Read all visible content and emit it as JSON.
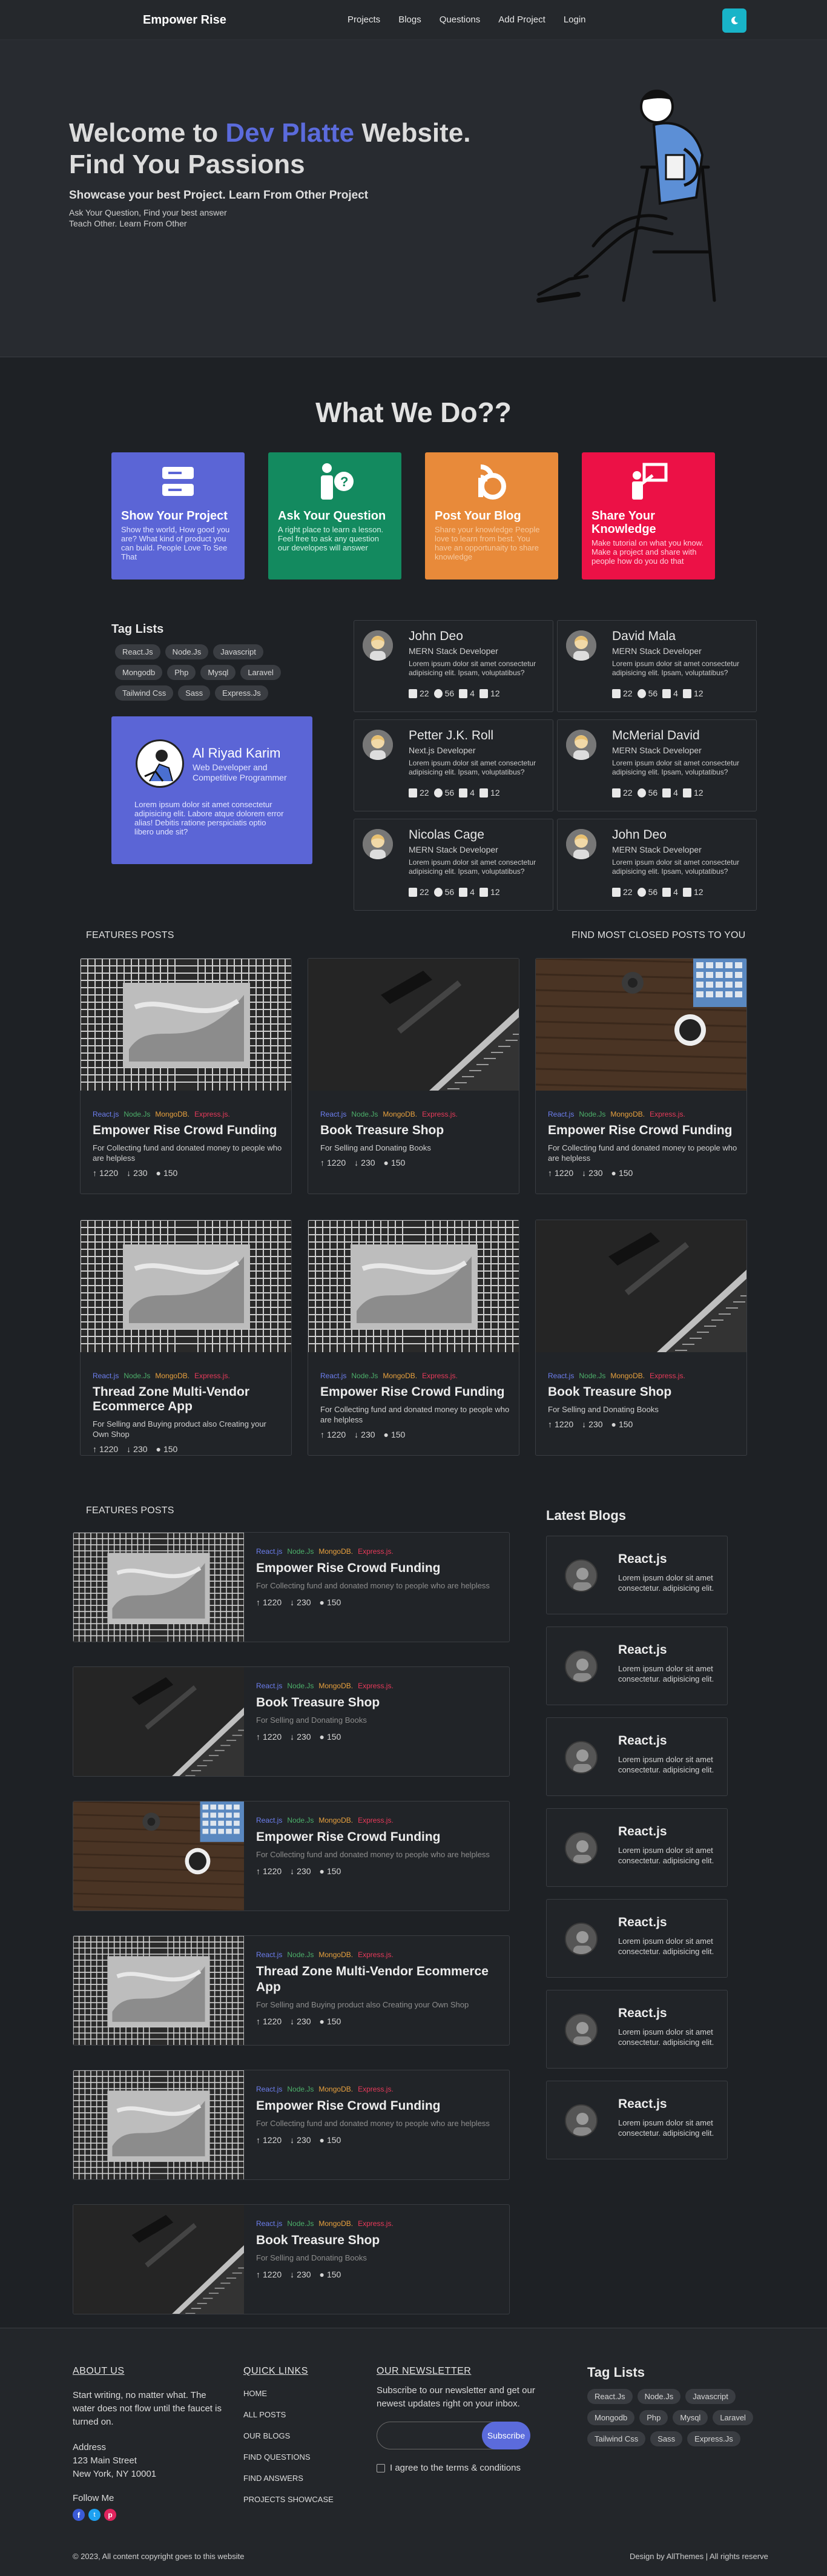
{
  "nav": {
    "brand": "Empower Rise",
    "links": [
      "Projects",
      "Blogs",
      "Questions",
      "Add Project",
      "Login"
    ]
  },
  "hero": {
    "title_pre": "Welcome to ",
    "title_highlight": "Dev Platte",
    "title_post": " Website. Find You Passions",
    "subtitle": "Showcase your best Project. Learn From Other Project",
    "text": "Ask Your Question, Find your best answer Teach Other. Learn From Other"
  },
  "what": {
    "title": "What We Do??",
    "services": [
      {
        "title": "Show Your Project",
        "text": "Show the world, How good you are? What kind of product you can build. People Love To See That",
        "bg": "#5b65d6",
        "fg": "#e2e5ff"
      },
      {
        "title": "Ask Your Question",
        "text": "A right place to learn a lesson. Feel free to ask any question our developes will answer",
        "bg": "#138a5f",
        "fg": "#d6f2e7"
      },
      {
        "title": "Post Your Blog",
        "text": "Share your knowledge People love to learn from best. You have an opportunaity to share knowledge",
        "bg": "#e88a3a",
        "fg": "#f6c99f"
      },
      {
        "title": "Share Your Knowledge",
        "text": "Make tutorial on what you know. Make a project and share with people how do you do that",
        "bg": "#ec1146",
        "fg": "#ffd3dd"
      }
    ]
  },
  "tags": {
    "title": "Tag Lists",
    "items": [
      "React.Js",
      "Node.Js",
      "Javascript",
      "Mongodb",
      "Php",
      "Mysql",
      "Laravel",
      "Tailwind Css",
      "Sass",
      "Express.Js"
    ]
  },
  "author": {
    "name": "Al Riyad Karim",
    "role": "Web Developer and Competitive Programmer",
    "desc": "Lorem ipsum dolor sit amet consectetur adipisicing elit. Labore atque dolorem error alias! Debitis ratione perspiciatis optio libero unde sit?"
  },
  "profiles": [
    {
      "name": "John Deo",
      "role": "MERN Stack Developer",
      "desc": "Lorem ipsum dolor sit amet consectetur adipisicing elit. Ipsam, voluptatibus?",
      "s1": "22",
      "s2": "56",
      "s3": "4",
      "s4": "12"
    },
    {
      "name": "David Mala",
      "role": "MERN Stack Developer",
      "desc": "Lorem ipsum dolor sit amet consectetur adipisicing elit. Ipsam, voluptatibus?",
      "s1": "22",
      "s2": "56",
      "s3": "4",
      "s4": "12"
    },
    {
      "name": "Petter J.K. Roll",
      "role": "Next.js Developer",
      "desc": "Lorem ipsum dolor sit amet consectetur adipisicing elit. Ipsam, voluptatibus?",
      "s1": "22",
      "s2": "56",
      "s3": "4",
      "s4": "12"
    },
    {
      "name": "McMerial David",
      "role": "MERN Stack Developer",
      "desc": "Lorem ipsum dolor sit amet consectetur adipisicing elit. Ipsam, voluptatibus?",
      "s1": "22",
      "s2": "56",
      "s3": "4",
      "s4": "12"
    },
    {
      "name": "Nicolas Cage",
      "role": "MERN Stack Developer",
      "desc": "Lorem ipsum dolor sit amet consectetur adipisicing elit. Ipsam, voluptatibus?",
      "s1": "22",
      "s2": "56",
      "s3": "4",
      "s4": "12"
    },
    {
      "name": "John Deo",
      "role": "MERN Stack Developer",
      "desc": "Lorem ipsum dolor sit amet consectetur adipisicing elit. Ipsam, voluptatibus?",
      "s1": "22",
      "s2": "56",
      "s3": "4",
      "s4": "12"
    }
  ],
  "features": {
    "label_left": "FEATURES POSTS",
    "label_right": "FIND MOST CLOSED POSTS TO YOU",
    "techs": [
      "React.js",
      "Node.Js",
      "MongoDB.",
      "Express.js."
    ],
    "cards": [
      {
        "title": "Empower Rise Crowd Funding",
        "desc": "For Collecting fund and donated money to people who are helpless",
        "img": "building",
        "up": "1220",
        "down": "230",
        "comments": "150"
      },
      {
        "title": "Book Treasure Shop",
        "desc": "For Selling and Donating Books",
        "img": "laptop",
        "up": "1220",
        "down": "230",
        "comments": "150"
      },
      {
        "title": "Empower Rise Crowd Funding",
        "desc": "For Collecting fund and donated money to people who are helpless",
        "img": "desk",
        "up": "1220",
        "down": "230",
        "comments": "150"
      },
      {
        "title": "Thread Zone Multi-Vendor Ecommerce App",
        "desc": "For Selling and Buying product also Creating your Own Shop",
        "img": "building",
        "up": "1220",
        "down": "230",
        "comments": "150"
      },
      {
        "title": "Empower Rise Crowd Funding",
        "desc": "For Collecting fund and donated money to people who are helpless",
        "img": "building",
        "up": "1220",
        "down": "230",
        "comments": "150"
      },
      {
        "title": "Book Treasure Shop",
        "desc": "For Selling and Donating Books",
        "img": "laptop",
        "up": "1220",
        "down": "230",
        "comments": "150"
      }
    ]
  },
  "list": {
    "label": "FEATURES POSTS",
    "cards": [
      {
        "title": "Empower Rise Crowd Funding",
        "desc": "For Collecting fund and donated money to people who are helpless",
        "img": "building",
        "up": "1220",
        "down": "230",
        "comments": "150"
      },
      {
        "title": "Book Treasure Shop",
        "desc": "For Selling and Donating Books",
        "img": "laptop",
        "up": "1220",
        "down": "230",
        "comments": "150"
      },
      {
        "title": "Empower Rise Crowd Funding",
        "desc": "For Collecting fund and donated money to people who are helpless",
        "img": "desk",
        "up": "1220",
        "down": "230",
        "comments": "150"
      },
      {
        "title": "Thread Zone Multi-Vendor Ecommerce App",
        "desc": "For Selling and Buying product also Creating your Own Shop",
        "img": "building",
        "up": "1220",
        "down": "230",
        "comments": "150"
      },
      {
        "title": "Empower Rise Crowd Funding",
        "desc": "For Collecting fund and donated money to people who are helpless",
        "img": "building",
        "up": "1220",
        "down": "230",
        "comments": "150"
      },
      {
        "title": "Book Treasure Shop",
        "desc": "For Selling and Donating Books",
        "img": "laptop",
        "up": "1220",
        "down": "230",
        "comments": "150"
      }
    ]
  },
  "blogs": {
    "title": "Latest Blogs",
    "items": [
      {
        "title": "React.js",
        "desc": "Lorem ipsum dolor sit amet consectetur. adipisicing elit."
      },
      {
        "title": "React.js",
        "desc": "Lorem ipsum dolor sit amet consectetur. adipisicing elit."
      },
      {
        "title": "React.js",
        "desc": "Lorem ipsum dolor sit amet consectetur. adipisicing elit."
      },
      {
        "title": "React.js",
        "desc": "Lorem ipsum dolor sit amet consectetur. adipisicing elit."
      },
      {
        "title": "React.js",
        "desc": "Lorem ipsum dolor sit amet consectetur. adipisicing elit."
      },
      {
        "title": "React.js",
        "desc": "Lorem ipsum dolor sit amet consectetur. adipisicing elit."
      },
      {
        "title": "React.js",
        "desc": "Lorem ipsum dolor sit amet consectetur. adipisicing elit."
      }
    ]
  },
  "footer": {
    "about_title": "ABOUT US",
    "about_text": "Start writing, no matter what. The water does not flow until the faucet is turned on.",
    "address_label": "Address",
    "address_line1": "123 Main Street",
    "address_line2": "New York, NY 10001",
    "follow": "Follow Me",
    "quick_title": "QUICK LINKS",
    "quick_links": [
      "HOME",
      "ALL POSTS",
      "OUR BLOGS",
      "FIND QUESTIONS",
      "FIND ANSWERS",
      "PROJECTS SHOWCASE"
    ],
    "news_title": "OUR NEWSLETTER",
    "news_text": "Subscribe to our newsletter and get our newest updates right on your inbox.",
    "subscribe": "Subscribe",
    "agree": "I agree to the terms & conditions",
    "tags_title": "Tag Lists",
    "tags": [
      "React.Js",
      "Node.Js",
      "Javascript",
      "Mongodb",
      "Php",
      "Mysql",
      "Laravel",
      "Tailwind Css",
      "Sass",
      "Express.Js"
    ],
    "copyright": "© 2023, All content copyright goes to this website",
    "design": "Design by AllThemes | All rights reserve"
  }
}
